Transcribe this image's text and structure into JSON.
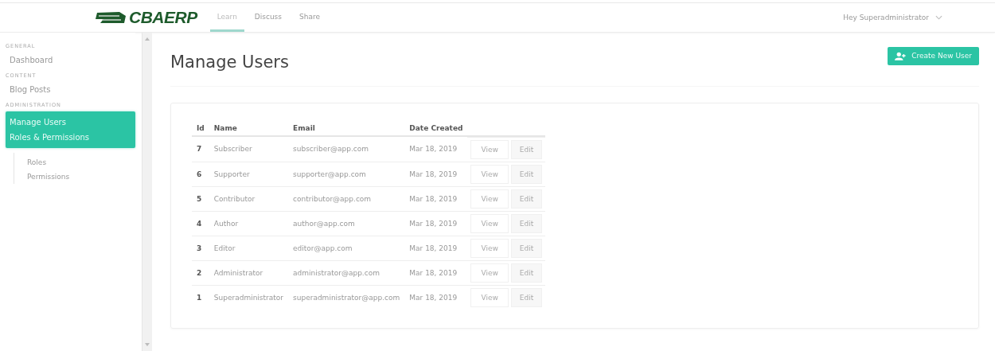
{
  "topbar": {
    "logo": "CBAERP",
    "tabs": [
      {
        "label": "Learn",
        "selected": true
      },
      {
        "label": "Discuss",
        "selected": false
      },
      {
        "label": "Share",
        "selected": false
      }
    ],
    "user_menu": "Hey Superadministrator"
  },
  "sidebar": {
    "sections": [
      {
        "label": "GENERAL",
        "items": [
          {
            "label": "Dashboard",
            "selected": false
          }
        ]
      },
      {
        "label": "CONTENT",
        "items": [
          {
            "label": "Blog Posts",
            "selected": false
          }
        ]
      },
      {
        "label": "ADMINISTRATION",
        "items": [
          {
            "label": "Manage Users",
            "selected": true
          },
          {
            "label": "Roles & Permissions",
            "selected": true,
            "children": [
              {
                "label": "Roles",
                "selected": false
              },
              {
                "label": "Permissions",
                "selected": false
              }
            ]
          }
        ]
      }
    ]
  },
  "page": {
    "title": "Manage Users",
    "create_button": "Create New User"
  },
  "table": {
    "columns": [
      "Id",
      "Name",
      "Email",
      "Date Created"
    ],
    "rows": [
      {
        "id": "7",
        "name": "Subscriber",
        "email": "subscriber@app.com",
        "date": "Mar 18, 2019",
        "actions": [
          "View",
          "Edit"
        ]
      },
      {
        "id": "6",
        "name": "Supporter",
        "email": "supporter@app.com",
        "date": "Mar 18, 2019",
        "actions": [
          "View",
          "Edit"
        ]
      },
      {
        "id": "5",
        "name": "Contributor",
        "email": "contributor@app.com",
        "date": "Mar 18, 2019",
        "actions": [
          "View",
          "Edit"
        ]
      },
      {
        "id": "4",
        "name": "Author",
        "email": "author@app.com",
        "date": "Mar 18, 2019",
        "actions": [
          "View",
          "Edit"
        ]
      },
      {
        "id": "3",
        "name": "Editor",
        "email": "editor@app.com",
        "date": "Mar 18, 2019",
        "actions": [
          "View",
          "Edit"
        ]
      },
      {
        "id": "2",
        "name": "Administrator",
        "email": "administrator@app.com",
        "date": "Mar 18, 2019",
        "actions": [
          "View",
          "Edit"
        ]
      },
      {
        "id": "1",
        "name": "Superadministrator",
        "email": "superadministrator@app.com",
        "date": "Mar 18, 2019",
        "actions": [
          "View",
          "Edit"
        ]
      }
    ]
  }
}
